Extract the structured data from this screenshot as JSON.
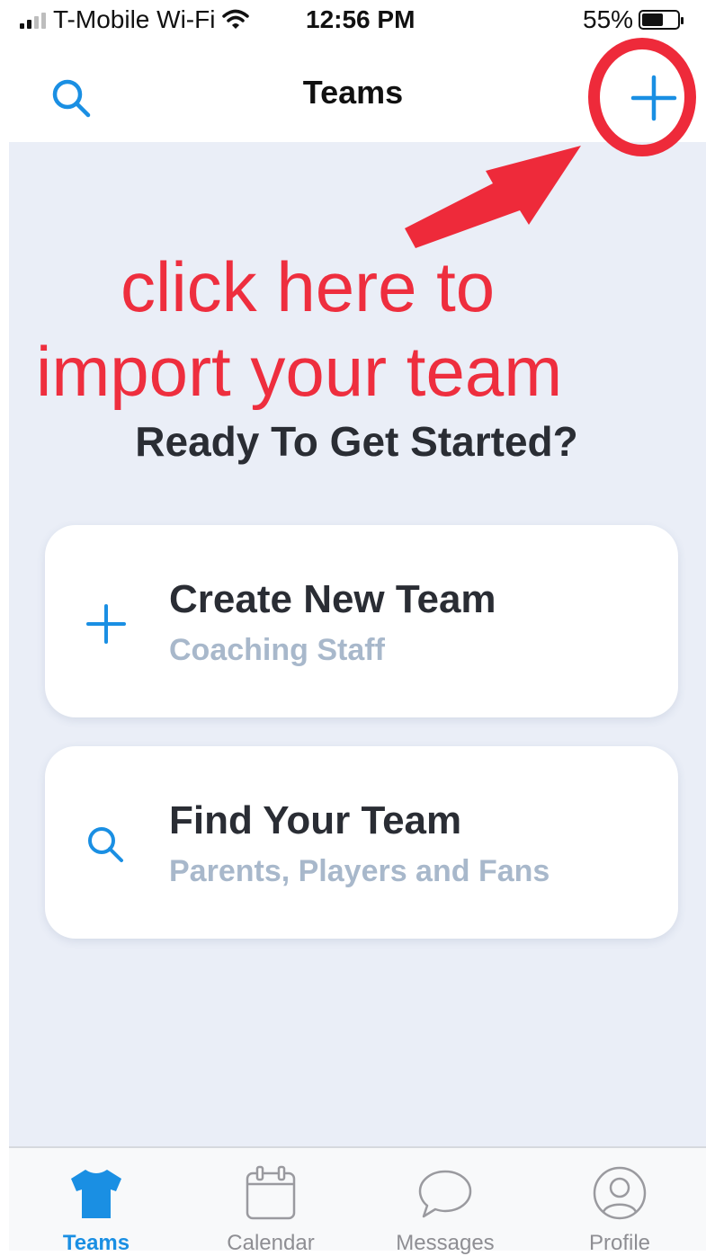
{
  "status_bar": {
    "carrier": "T-Mobile Wi-Fi",
    "time": "12:56 PM",
    "battery": "55%",
    "battery_level": 0.55
  },
  "nav": {
    "title": "Teams",
    "left_icon": "search-icon",
    "right_icon": "plus-icon"
  },
  "annotation": {
    "line1": "click here to",
    "line2": "import your team",
    "color": "#ee2a3a"
  },
  "main": {
    "heading": "Ready To Get Started?",
    "cards": [
      {
        "icon": "plus-icon",
        "title": "Create New Team",
        "subtitle": "Coaching Staff"
      },
      {
        "icon": "search-icon",
        "title": "Find Your Team",
        "subtitle": "Parents, Players and Fans"
      }
    ]
  },
  "tab_bar": {
    "items": [
      {
        "label": "Teams",
        "icon": "jersey-icon",
        "active": true
      },
      {
        "label": "Calendar",
        "icon": "calendar-icon",
        "active": false
      },
      {
        "label": "Messages",
        "icon": "chat-bubble-icon",
        "active": false
      },
      {
        "label": "Profile",
        "icon": "profile-icon",
        "active": false
      }
    ]
  },
  "colors": {
    "accent": "#1a8fe3",
    "background": "#eaeef7",
    "subtitle": "#a8b8cb",
    "annotation": "#ee2a3a"
  }
}
